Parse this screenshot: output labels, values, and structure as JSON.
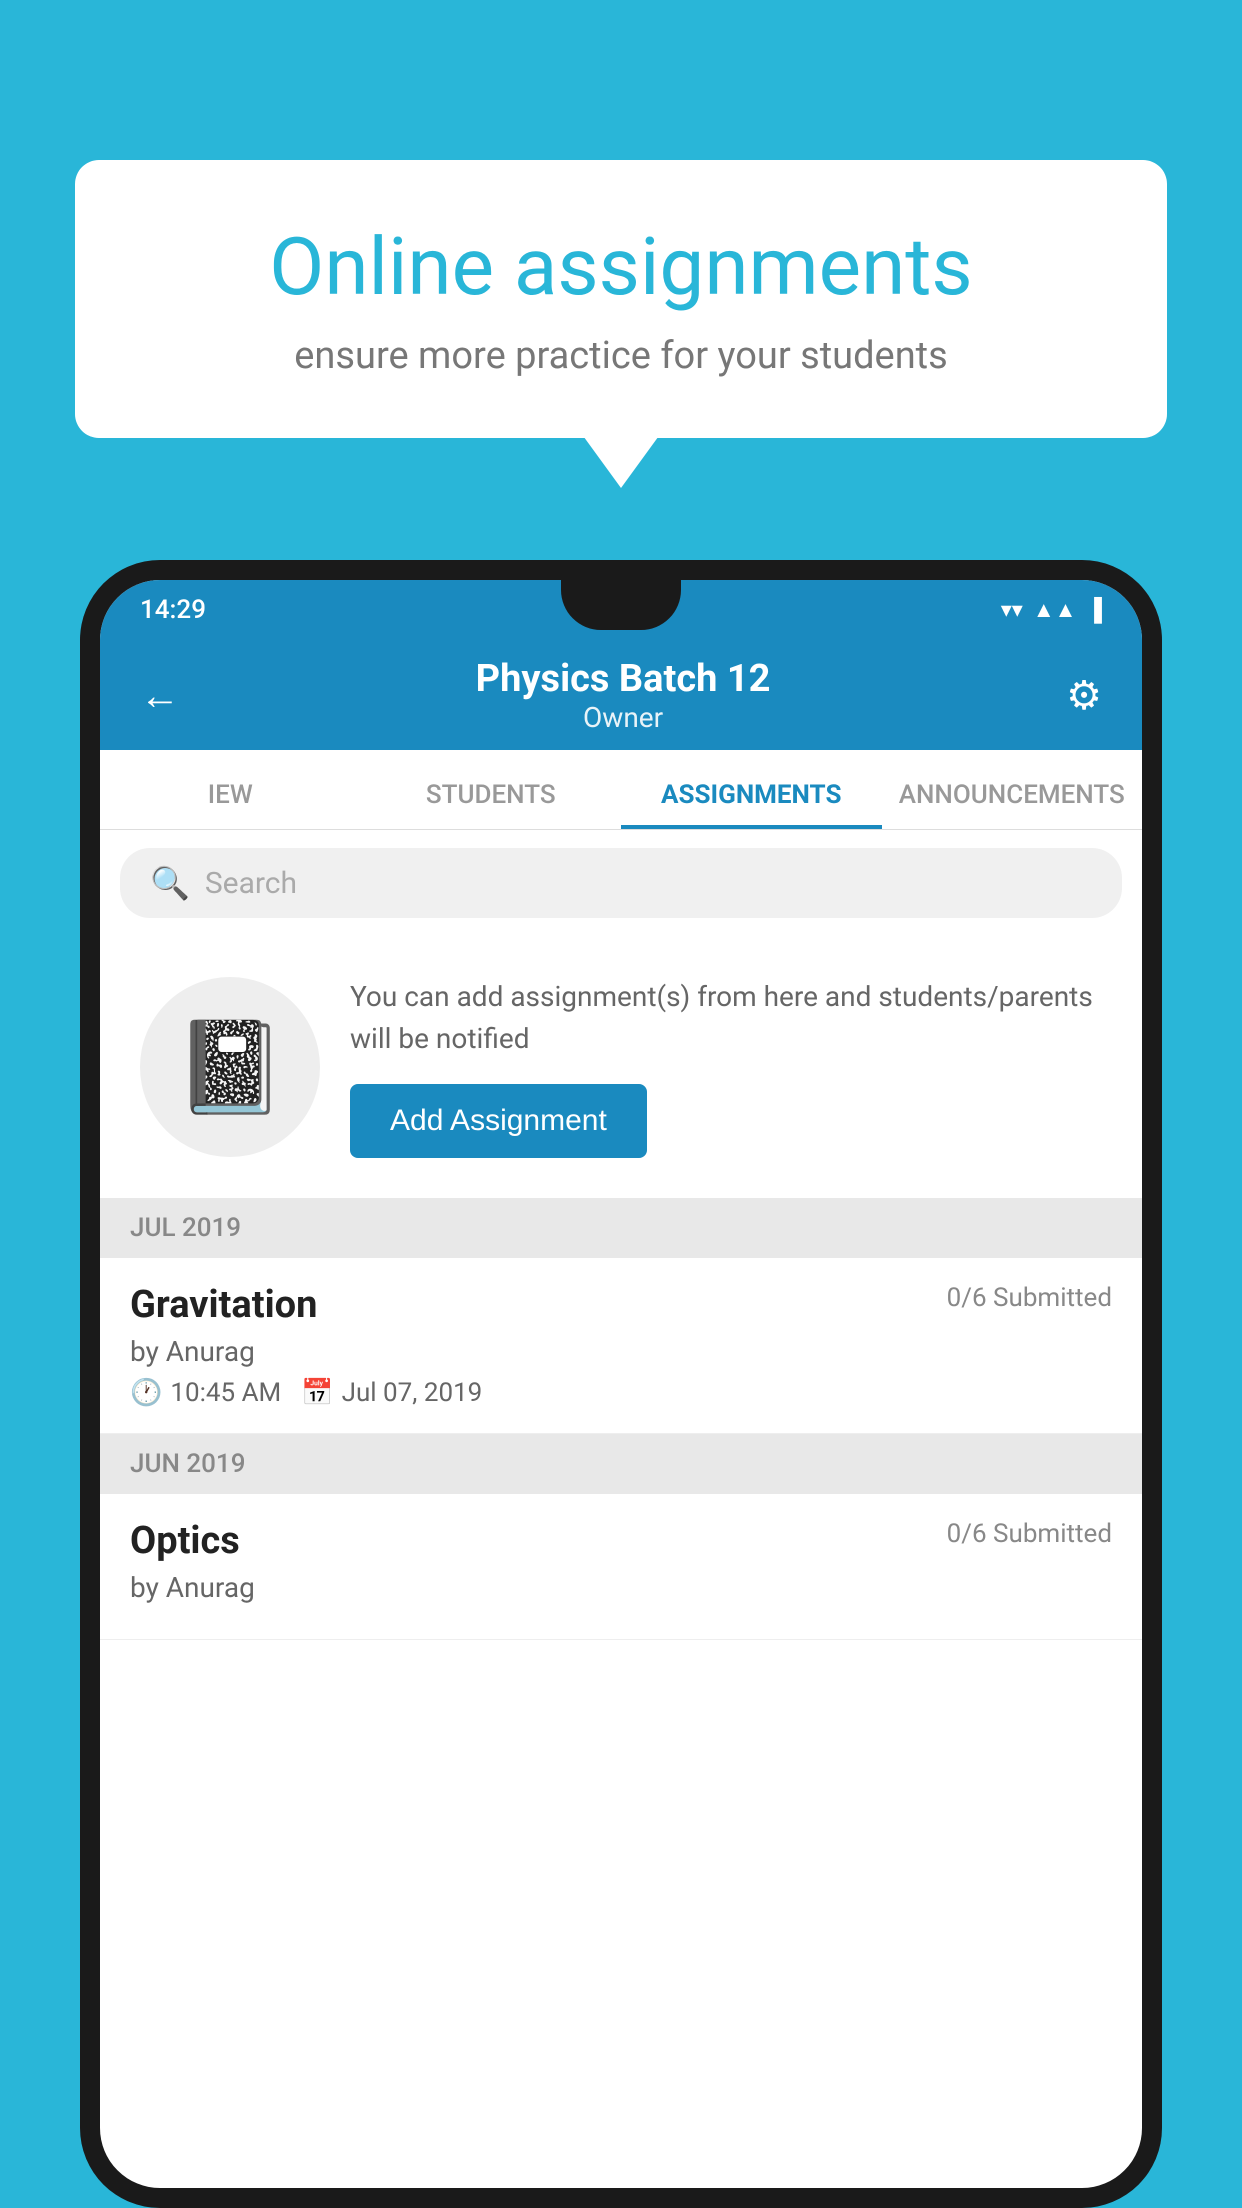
{
  "background_color": "#29B6D8",
  "speech_bubble": {
    "title": "Online assignments",
    "subtitle": "ensure more practice for your students"
  },
  "phone": {
    "status_bar": {
      "time": "14:29",
      "wifi": "▼",
      "signal": "▲",
      "battery": "■"
    },
    "header": {
      "title": "Physics Batch 12",
      "subtitle": "Owner",
      "back_label": "←",
      "settings_label": "⚙"
    },
    "tabs": [
      {
        "label": "IEW",
        "active": false
      },
      {
        "label": "STUDENTS",
        "active": false
      },
      {
        "label": "ASSIGNMENTS",
        "active": true
      },
      {
        "label": "ANNOUNCEMENTS",
        "active": false
      }
    ],
    "search": {
      "placeholder": "Search"
    },
    "info_card": {
      "description": "You can add assignment(s) from here and students/parents will be notified",
      "button_label": "Add Assignment"
    },
    "sections": [
      {
        "month": "JUL 2019",
        "assignments": [
          {
            "title": "Gravitation",
            "submitted": "0/6 Submitted",
            "author": "by Anurag",
            "time": "10:45 AM",
            "date": "Jul 07, 2019"
          }
        ]
      },
      {
        "month": "JUN 2019",
        "assignments": [
          {
            "title": "Optics",
            "submitted": "0/6 Submitted",
            "author": "by Anurag",
            "time": "",
            "date": ""
          }
        ]
      }
    ]
  }
}
